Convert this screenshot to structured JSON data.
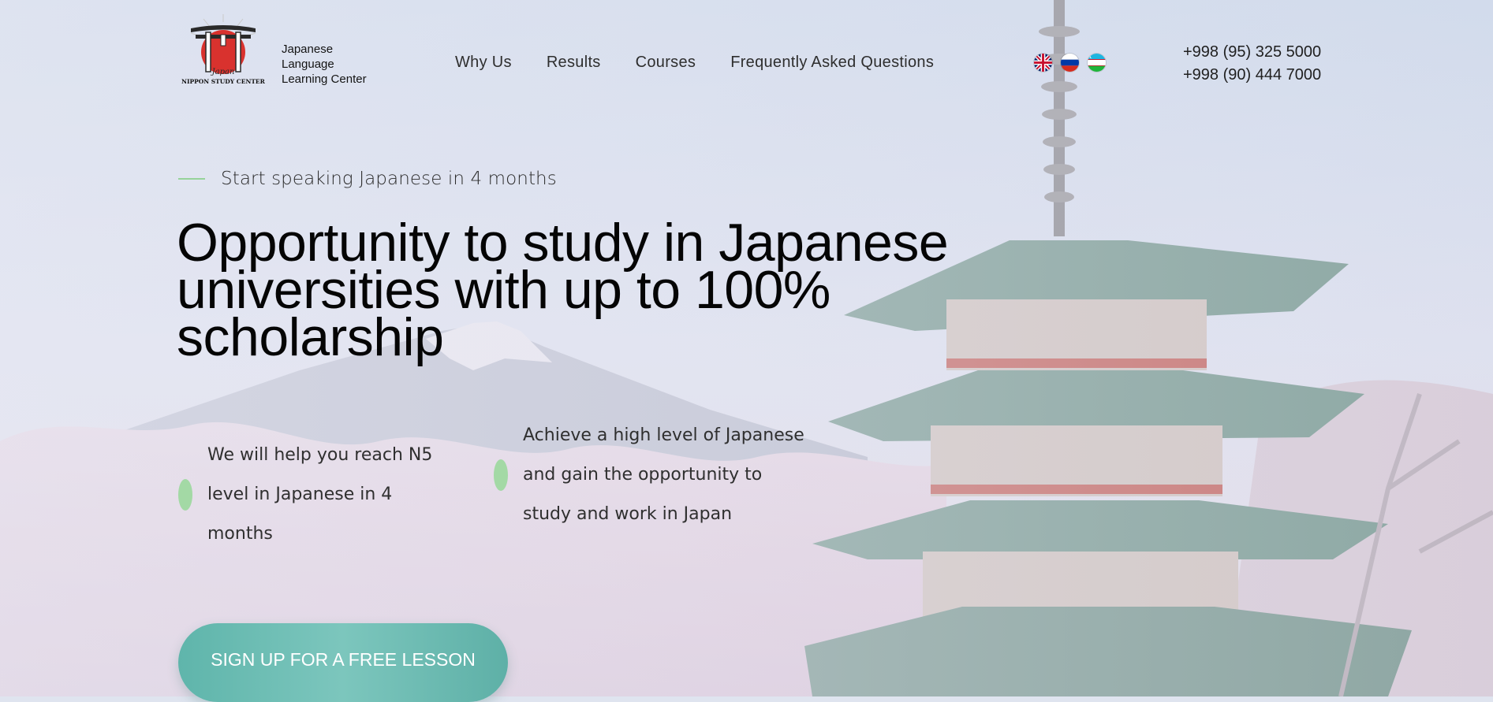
{
  "brand": {
    "logo_caption": "NIPPON STUDY CENTER",
    "logo_script": "Japan",
    "name_lines": [
      "Japanese",
      "Language",
      "Learning Center"
    ]
  },
  "nav": {
    "items": [
      "Why Us",
      "Results",
      "Courses",
      "Frequently Asked Questions"
    ]
  },
  "languages": [
    {
      "icon": "uk-flag-icon"
    },
    {
      "icon": "russia-flag-icon"
    },
    {
      "icon": "uzbekistan-flag-icon"
    }
  ],
  "contacts": {
    "phones": [
      "+998 (95) 325 5000",
      "+998 (90) 444 7000"
    ]
  },
  "hero": {
    "tagline": "Start speaking Japanese in 4 months",
    "title": "Opportunity to study in Japanese universities with up to 100% scholarship",
    "features": [
      "We will help you reach N5 level in Japanese in 4 months",
      "Achieve a high level of Japanese and gain the opportunity to study and work in Japan"
    ],
    "cta_label": "SIGN UP FOR A FREE LESSON"
  },
  "colors": {
    "accent_teal": "#6ebdb3",
    "leaf_green": "#a3d9a5",
    "logo_red": "#d9322e"
  }
}
